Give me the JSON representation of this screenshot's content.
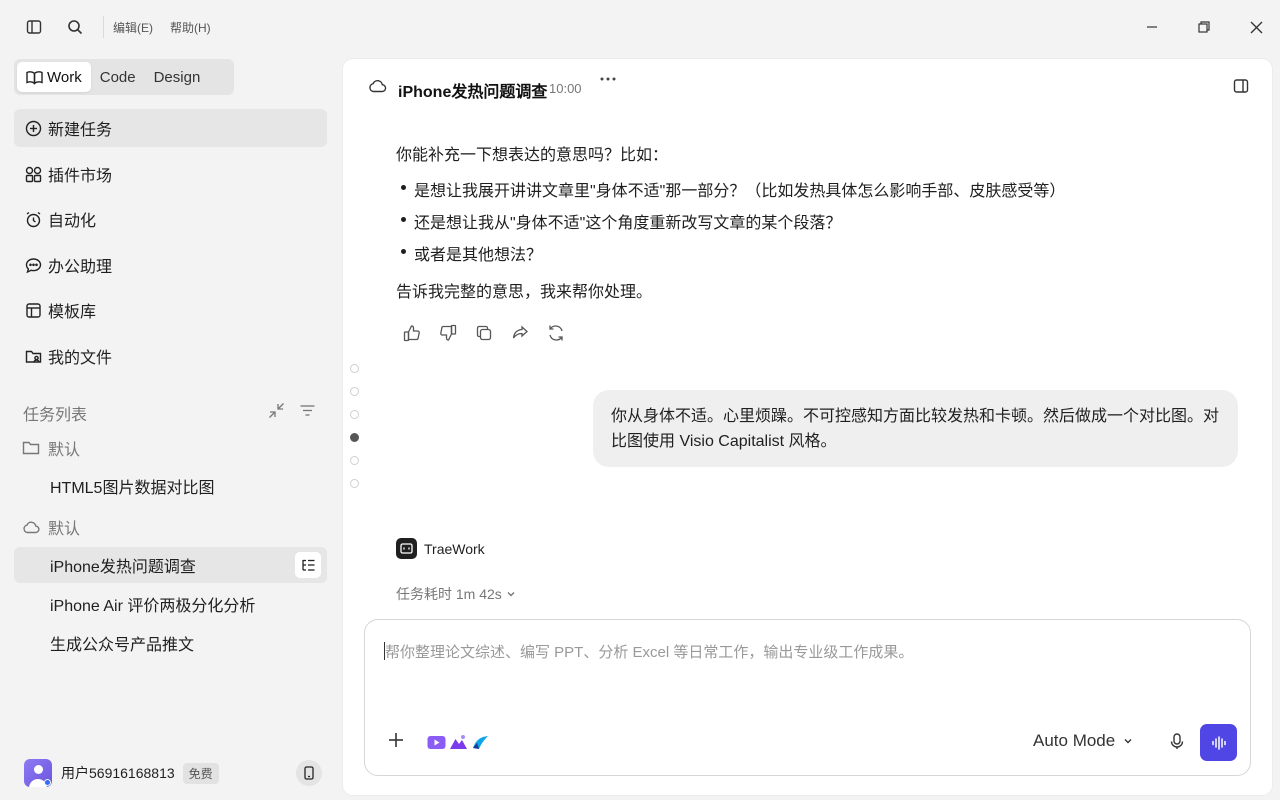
{
  "menu": {
    "edit": "编辑(E)",
    "help": "帮助(H)"
  },
  "mode_tabs": [
    {
      "label": "Work",
      "active": true
    },
    {
      "label": "Code"
    },
    {
      "label": "Design"
    }
  ],
  "nav": [
    {
      "label": "新建任务",
      "icon": "plus-circle-icon"
    },
    {
      "label": "插件市场",
      "icon": "plugin-grid-icon"
    },
    {
      "label": "自动化",
      "icon": "alarm-clock-icon"
    },
    {
      "label": "办公助理",
      "icon": "chat-bubble-icon"
    },
    {
      "label": "模板库",
      "icon": "template-icon"
    },
    {
      "label": "我的文件",
      "icon": "folder-user-icon"
    }
  ],
  "tasks": {
    "title": "任务列表",
    "groups": [
      {
        "label": "默认",
        "icon": "folder-icon",
        "items": [
          "HTML5图片数据对比图"
        ]
      },
      {
        "label": "默认",
        "icon": "cloud-icon",
        "items": [
          "iPhone发热问题调查",
          "iPhone Air 评价两极分化分析",
          "生成公众号产品推文"
        ]
      }
    ],
    "active_item": "iPhone发热问题调查"
  },
  "user": {
    "name": "用户56916168813",
    "plan": "免费"
  },
  "conversation": {
    "title": "iPhone发热问题调查",
    "time": "10:00",
    "ai_intro": "你能补充一下想表达的意思吗？比如：",
    "ai_bullets": [
      "是想让我展开讲讲文章里\"身体不适\"那一部分？（比如发热具体怎么影响手部、皮肤感受等）",
      "还是想让我从\"身体不适\"这个角度重新改写文章的某个段落？",
      "或者是其他想法？"
    ],
    "ai_outro": "告诉我完整的意思，我来帮你处理。",
    "user_message": "你从身体不适。心里烦躁。不可控感知方面比较发热和卡顿。然后做成一个对比图。对比图使用 Visio Capitalist 风格。",
    "agent_name": "TraeWork",
    "duration": "任务耗时 1m 42s"
  },
  "composer": {
    "placeholder": "帮你整理论文综述、编写 PPT、分析 Excel 等日常工作，输出专业级工作成果。",
    "mode": "Auto Mode"
  },
  "colors": {
    "accent": "#4f46e5",
    "sidebar_bg": "#f3f3f3",
    "active_bg": "#e6e6e6",
    "bubble_bg": "#efefef"
  }
}
